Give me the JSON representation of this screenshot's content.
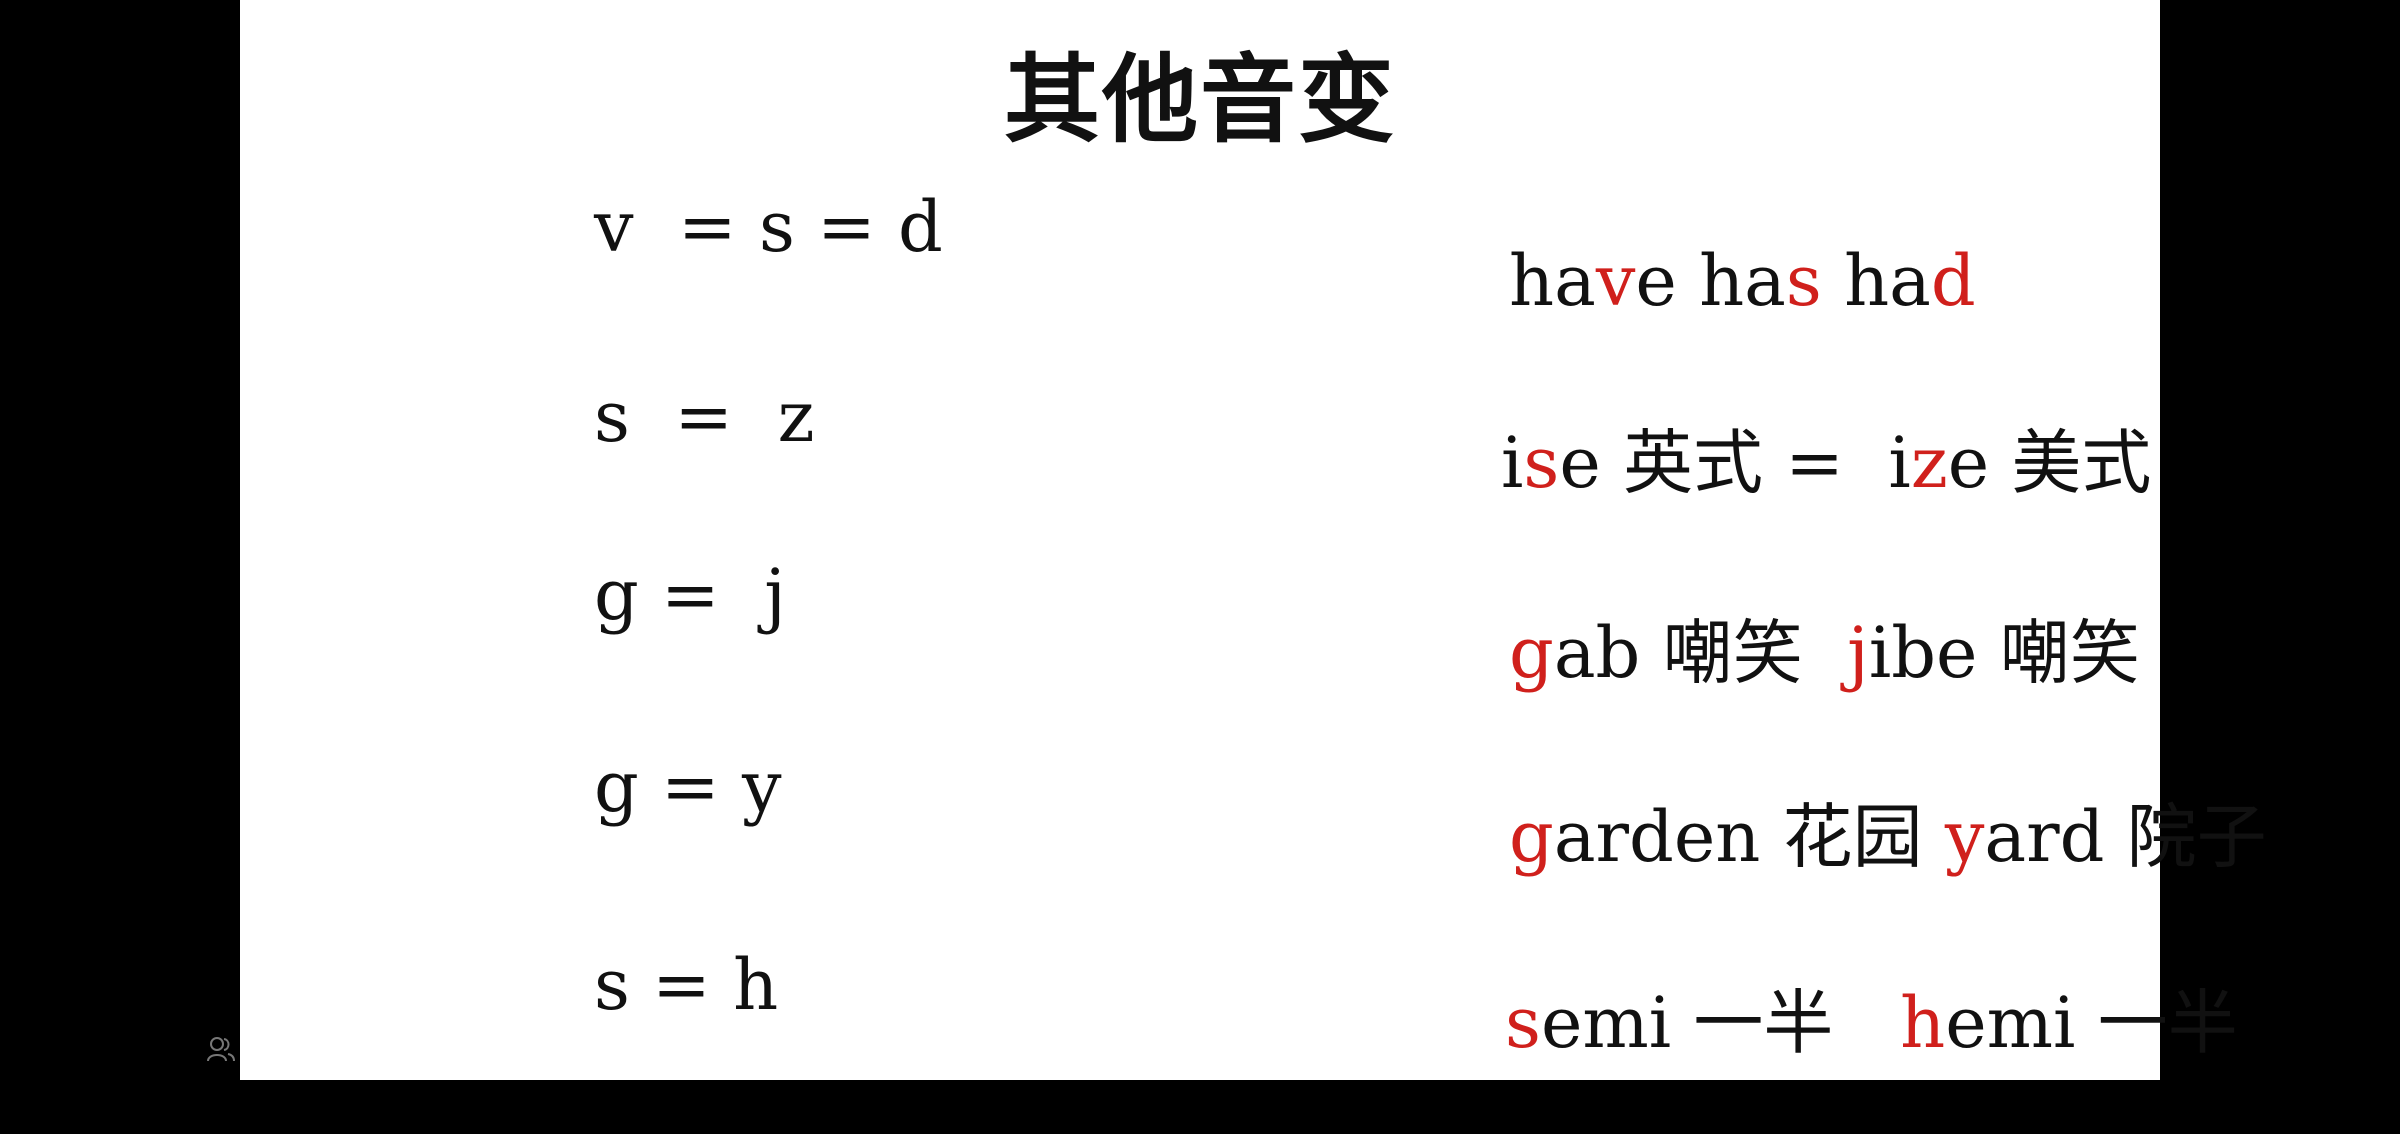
{
  "title": "其他音变",
  "rules": [
    "v  = s = d",
    "s  =  z",
    "g =  j",
    "g = y",
    "s = h"
  ],
  "examples": [
    [
      {
        "t": "ha",
        "hl": false
      },
      {
        "t": "v",
        "hl": true
      },
      {
        "t": "e ha",
        "hl": false
      },
      {
        "t": "s",
        "hl": true
      },
      {
        "t": " ha",
        "hl": false
      },
      {
        "t": "d",
        "hl": true
      }
    ],
    [
      {
        "t": "i",
        "hl": false
      },
      {
        "t": "s",
        "hl": true
      },
      {
        "t": "e 英式 =  i",
        "hl": false
      },
      {
        "t": "z",
        "hl": true
      },
      {
        "t": "e 美式",
        "hl": false
      }
    ],
    [
      {
        "t": "g",
        "hl": true
      },
      {
        "t": "ab 嘲笑  ",
        "hl": false
      },
      {
        "t": "j",
        "hl": true
      },
      {
        "t": "ibe 嘲笑",
        "hl": false
      }
    ],
    [
      {
        "t": "g",
        "hl": true
      },
      {
        "t": "arden 花园 ",
        "hl": false
      },
      {
        "t": "y",
        "hl": true
      },
      {
        "t": "ard 院子",
        "hl": false
      }
    ],
    [
      {
        "t": "s",
        "hl": true
      },
      {
        "t": "emi 一半   ",
        "hl": false
      },
      {
        "t": "h",
        "hl": true
      },
      {
        "t": "emi 一半",
        "hl": false
      }
    ]
  ],
  "colors": {
    "highlight": "#d0201c",
    "text": "#111111",
    "background": "#ffffff",
    "letterbox": "#000000"
  },
  "icons": {
    "corner": "people-icon"
  }
}
